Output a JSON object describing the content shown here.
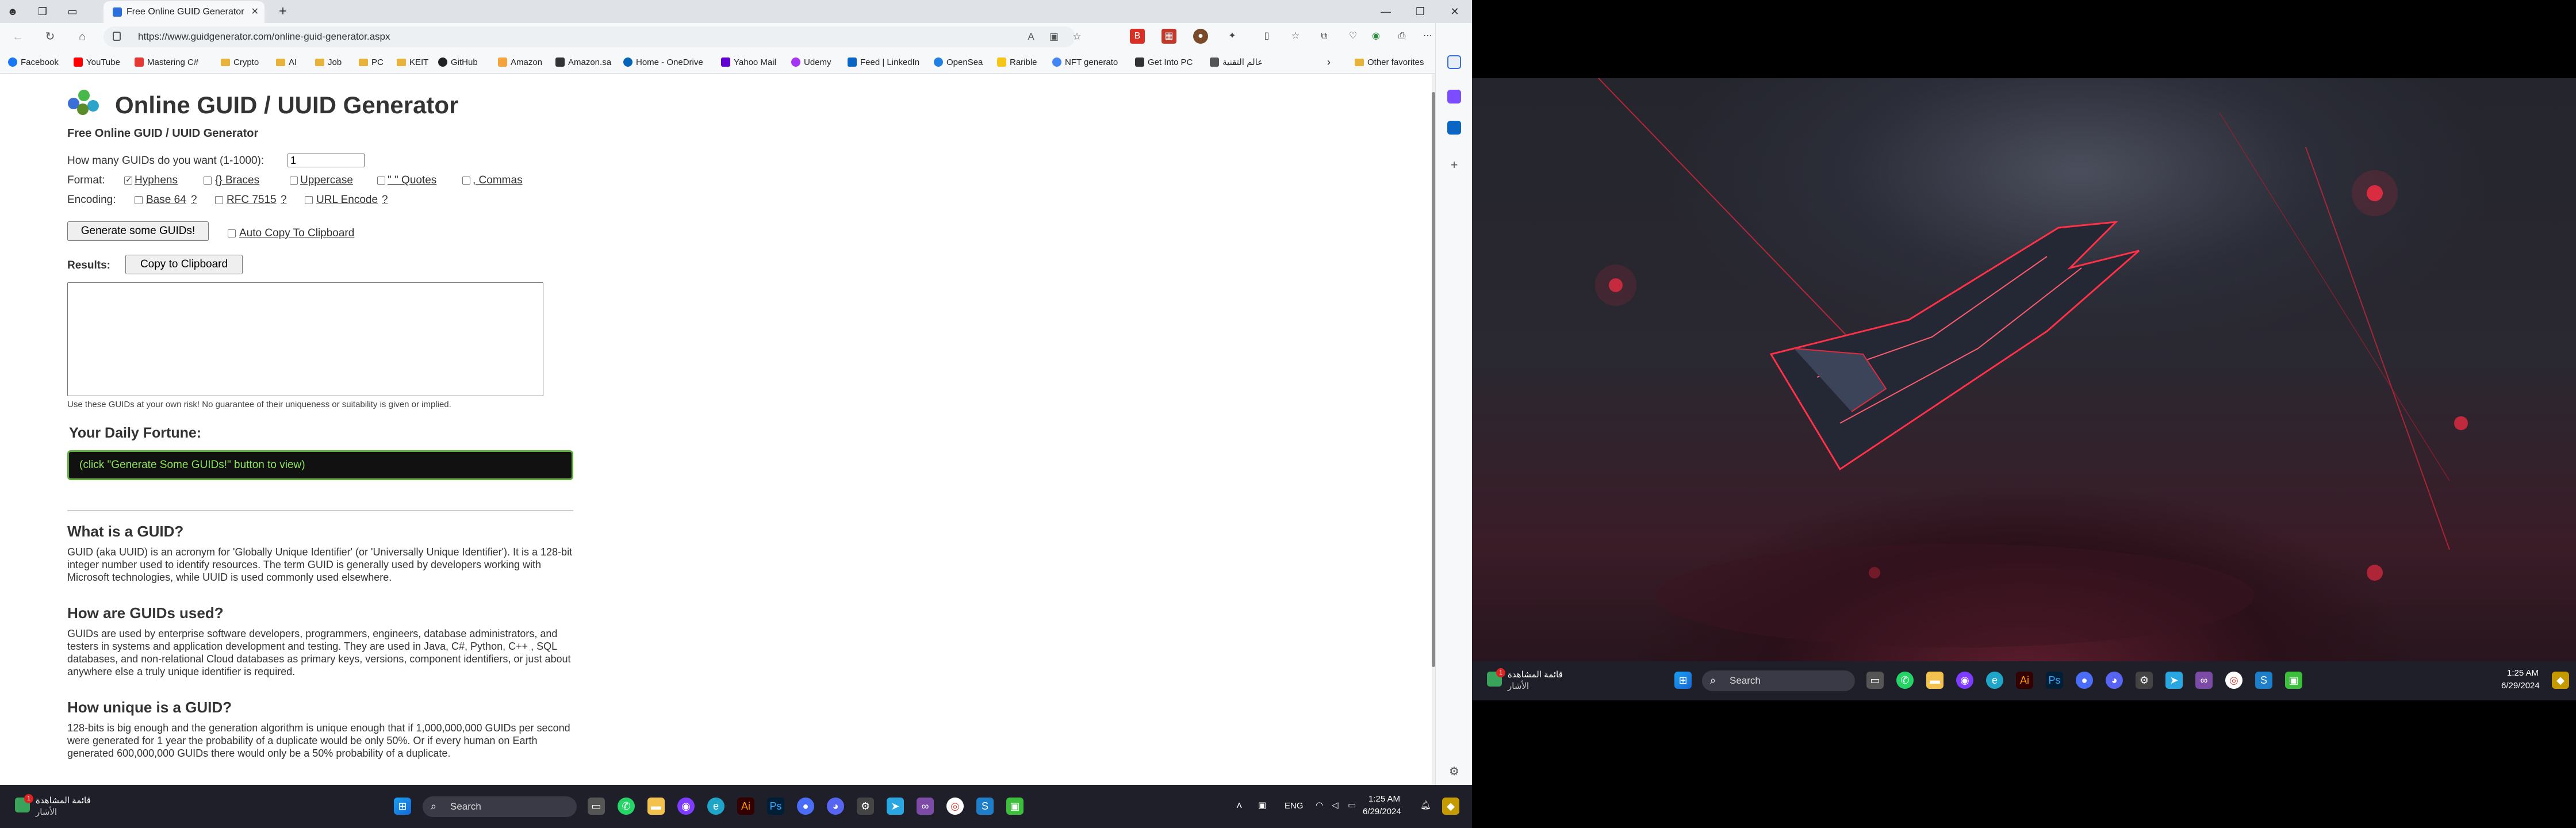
{
  "browser": {
    "tab_title": "Free Online GUID Generator",
    "url": "https://www.guidgenerator.com/online-guid-generator.aspx",
    "bookmarks": [
      "Facebook",
      "YouTube",
      "Mastering C#",
      "Crypto",
      "AI",
      "Job",
      "PC",
      "KEIT",
      "GitHub",
      "Amazon",
      "Amazon.sa",
      "Home - OneDrive",
      "Yahoo Mail",
      "Udemy",
      "Feed | LinkedIn",
      "OpenSea",
      "Rarible",
      "NFT generato",
      "Get Into PC",
      "عالم التقنية"
    ],
    "other_favorites": "Other favorites"
  },
  "page": {
    "title": "Online GUID / UUID Generator",
    "subtitle": "Free Online GUID / UUID Generator",
    "count_label": "How many GUIDs do you want (1-1000):",
    "count_value": "1",
    "format_label": "Format:",
    "format_options": {
      "hyphens": "Hyphens",
      "braces": "{} Braces",
      "uppercase": "Uppercase",
      "quotes": "\" \" Quotes",
      "commas": ", Commas"
    },
    "format_checked": {
      "hyphens": true,
      "braces": false,
      "uppercase": false,
      "quotes": false,
      "commas": false
    },
    "encoding_label": "Encoding:",
    "encoding_options": {
      "base64": "Base 64",
      "rfc7515": "RFC 7515",
      "urlencode": "URL Encode"
    },
    "help_mark": "?",
    "generate_button": "Generate some GUIDs!",
    "auto_copy_label": "Auto Copy To Clipboard",
    "results_label": "Results:",
    "copy_button": "Copy to Clipboard",
    "disclaimer": "Use these GUIDs at your own risk! No guarantee of their uniqueness or suitability is given or implied.",
    "fortune_heading": "Your Daily Fortune:",
    "fortune_text": "(click \"Generate Some GUIDs!\" button to view)",
    "sections": [
      {
        "heading": "What is a GUID?",
        "text": "GUID (aka UUID) is an acronym for 'Globally Unique Identifier' (or 'Universally Unique Identifier'). It is a 128-bit integer number used to identify resources. The term GUID is generally used by developers working with Microsoft technologies, while UUID is used commonly used elsewhere."
      },
      {
        "heading": "How are GUIDs used?",
        "text": "GUIDs are used by enterprise software developers, programmers, engineers, database administrators, and testers in systems and application development and testing. They are used in Java, C#, Python, C++ , SQL databases, and non-relational Cloud databases as primary keys, versions, component identifiers, or just about anywhere else a truly unique identifier is required."
      },
      {
        "heading": "How unique is a GUID?",
        "text": "128-bits is big enough and the generation algorithm is unique enough that if 1,000,000,000 GUIDs per second were generated for 1 year the probability of a duplicate would be only 50%. Or if every human on Earth generated 600,000,000 GUIDs there would only be a 50% probability of a duplicate."
      }
    ]
  },
  "taskbar_left": {
    "widget_title": "قائمة المشاهدة",
    "widget_sub": "الأشار",
    "widget_badge": "1",
    "search": "Search",
    "lang": "ENG",
    "time": "1:25 AM",
    "date": "6/29/2024"
  },
  "taskbar_right": {
    "widget_title": "قائمة المشاهدة",
    "widget_sub": "الأشار",
    "widget_badge": "1",
    "search": "Search",
    "time": "1:25 AM",
    "date": "6/29/2024"
  },
  "colors": {
    "accent": "#1a73e8",
    "fortune_green": "#8de25a",
    "taskbar": "#1f1f2a"
  }
}
